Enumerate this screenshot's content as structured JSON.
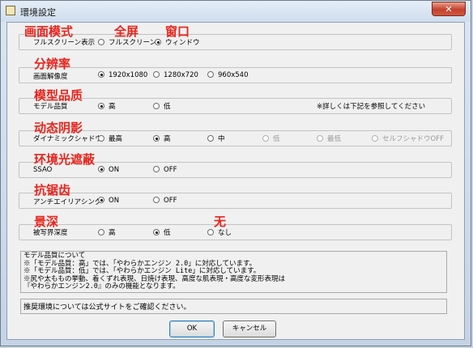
{
  "window": {
    "title": "環境設定",
    "close_label": "✕"
  },
  "settings": [
    {
      "annotation": "画面模式",
      "label": "フルスクリーン表示",
      "options": [
        {
          "label": "フルスクリーン",
          "selected": false
        },
        {
          "label": "ウィンドウ",
          "selected": true
        }
      ],
      "option_annotations": [
        "全屏",
        "窗口"
      ]
    },
    {
      "annotation": "分辨率",
      "label": "画面解像度",
      "options": [
        {
          "label": "1920x1080",
          "selected": true
        },
        {
          "label": "1280x720",
          "selected": false
        },
        {
          "label": "960x540",
          "selected": false
        }
      ]
    },
    {
      "annotation": "模型品质",
      "label": "モデル品質",
      "options": [
        {
          "label": "高",
          "selected": true
        },
        {
          "label": "低",
          "selected": false
        }
      ],
      "note": "※詳しくは下記を参照してください"
    },
    {
      "annotation": "动态阴影",
      "label": "ダイナミックシャドウ",
      "options": [
        {
          "label": "最高",
          "selected": false
        },
        {
          "label": "高",
          "selected": true
        },
        {
          "label": "中",
          "selected": false
        },
        {
          "label": "低",
          "selected": false,
          "disabled": true
        },
        {
          "label": "最低",
          "selected": false,
          "disabled": true
        },
        {
          "label": "セルフシャドウOFF",
          "selected": false,
          "disabled": true
        }
      ]
    },
    {
      "annotation": "环境光遮蔽",
      "label": "SSAO",
      "options": [
        {
          "label": "ON",
          "selected": true
        },
        {
          "label": "OFF",
          "selected": false
        }
      ]
    },
    {
      "annotation": "抗锯齿",
      "label": "アンチエイリアシング",
      "options": [
        {
          "label": "ON",
          "selected": true
        },
        {
          "label": "OFF",
          "selected": false
        }
      ]
    },
    {
      "annotation": "景深",
      "label": "被写界深度",
      "options": [
        {
          "label": "高",
          "selected": false
        },
        {
          "label": "低",
          "selected": true
        },
        {
          "label": "なし",
          "selected": false
        }
      ],
      "option_annotations": [
        "无"
      ]
    }
  ],
  "info_lines": [
    "モデル品質について",
    "※「モデル品質：高」では、「やわらかエンジン 2.0」に対応しています。",
    "※「モデル品質：低」では、「やわらかエンジン Lite」に対応しています。",
    "※尻や太ももの挙動、着くずれ表現、日焼け表現、高度な肌表現・高度な変形表現は",
    "『やわらかエンジン2.0』のみの機能となります。"
  ],
  "recommendation": "推奨環境については公式サイトをご確認ください。",
  "buttons": {
    "ok": "OK",
    "cancel": "キャンセル"
  },
  "colors": {
    "annotation": "#e8241c",
    "close_button": "#c4412c"
  }
}
